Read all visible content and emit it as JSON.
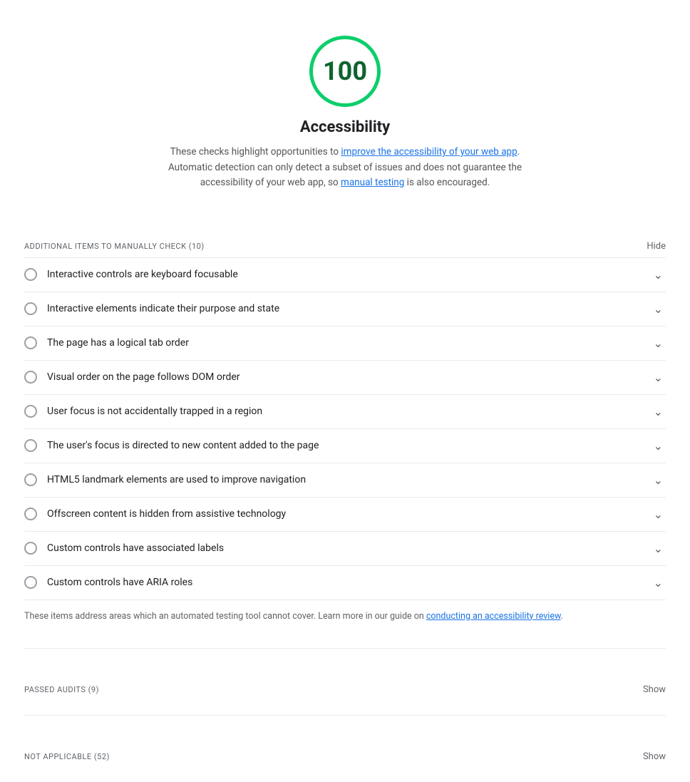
{
  "score": {
    "value": "100",
    "label": "Accessibility",
    "description_pre": "These checks highlight opportunities to ",
    "link1_text": "improve the accessibility of your web app",
    "link1_href": "#",
    "description_mid": ". Automatic detection can only detect a subset of issues and does not guarantee the accessibility of your web app, so ",
    "link2_text": "manual testing",
    "link2_href": "#",
    "description_post": " is also encouraged."
  },
  "manual_section": {
    "title": "ADDITIONAL ITEMS TO MANUALLY CHECK",
    "count": "(10)",
    "hide_label": "Hide"
  },
  "audit_items": [
    {
      "id": "item-1",
      "label": "Interactive controls are keyboard focusable"
    },
    {
      "id": "item-2",
      "label": "Interactive elements indicate their purpose and state"
    },
    {
      "id": "item-3",
      "label": "The page has a logical tab order"
    },
    {
      "id": "item-4",
      "label": "Visual order on the page follows DOM order"
    },
    {
      "id": "item-5",
      "label": "User focus is not accidentally trapped in a region"
    },
    {
      "id": "item-6",
      "label": "The user's focus is directed to new content added to the page"
    },
    {
      "id": "item-7",
      "label": "HTML5 landmark elements are used to improve navigation"
    },
    {
      "id": "item-8",
      "label": "Offscreen content is hidden from assistive technology"
    },
    {
      "id": "item-9",
      "label": "Custom controls have associated labels"
    },
    {
      "id": "item-10",
      "label": "Custom controls have ARIA roles"
    }
  ],
  "footer_note": {
    "pre": "These items address areas which an automated testing tool cannot cover. Learn more in our guide on ",
    "link_text": "conducting an accessibility review",
    "link_href": "#",
    "post": "."
  },
  "passed_section": {
    "title": "PASSED AUDITS",
    "count": "(9)",
    "show_label": "Show"
  },
  "not_applicable_section": {
    "title": "NOT APPLICABLE",
    "count": "(52)",
    "show_label": "Show"
  },
  "icons": {
    "chevron_down": "⌄",
    "circle_empty": ""
  }
}
